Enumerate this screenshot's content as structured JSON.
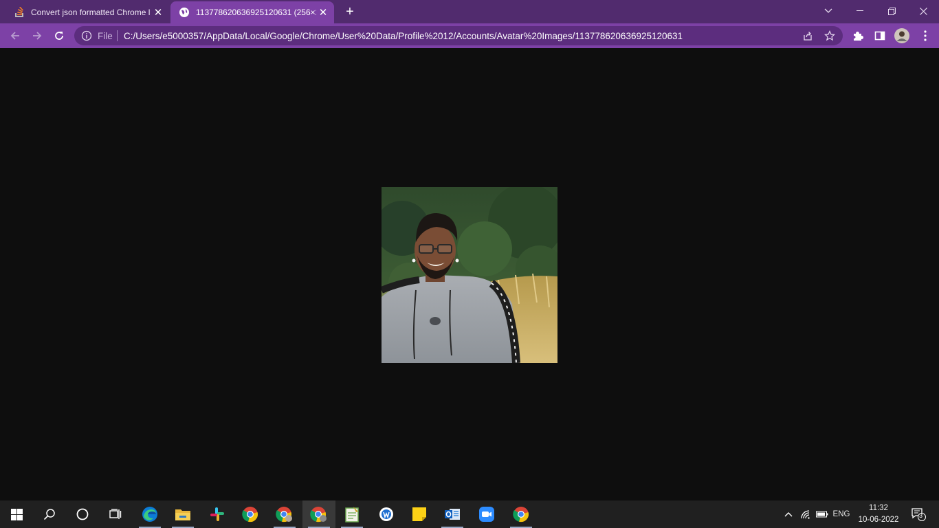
{
  "browser": {
    "tabs": [
      {
        "title": "Convert json formatted Chrome l",
        "favicon": "stack-overflow-icon",
        "active": false
      },
      {
        "title": "113778620636925120631 (256×2",
        "favicon": "globe-icon",
        "active": true
      }
    ],
    "address": {
      "scheme_label": "File",
      "url": "C:/Users/e5000357/AppData/Local/Google/Chrome/User%20Data/Profile%2012/Accounts/Avatar%20Images/113778620636925120631"
    },
    "colors": {
      "tabstrip": "#512b6e",
      "toolbar": "#7d41a6",
      "page_bg": "#0e0e0e"
    }
  },
  "viewer": {
    "image_alt": "Avatar photo"
  },
  "taskbar": {
    "apps": [
      "windows-start-icon",
      "search-icon",
      "cortana-icon",
      "task-view-icon",
      "edge-icon",
      "file-explorer-icon",
      "slack-icon",
      "chrome-icon",
      "chrome-profile-icon",
      "chrome-profile-active-icon",
      "notepad-plus-icon",
      "word-pad-icon",
      "sticky-notes-icon",
      "outlook-icon",
      "zoom-icon",
      "chrome-icon"
    ],
    "language": "ENG",
    "time": "11:32",
    "date": "10-06-2022",
    "notification_count": "3"
  }
}
